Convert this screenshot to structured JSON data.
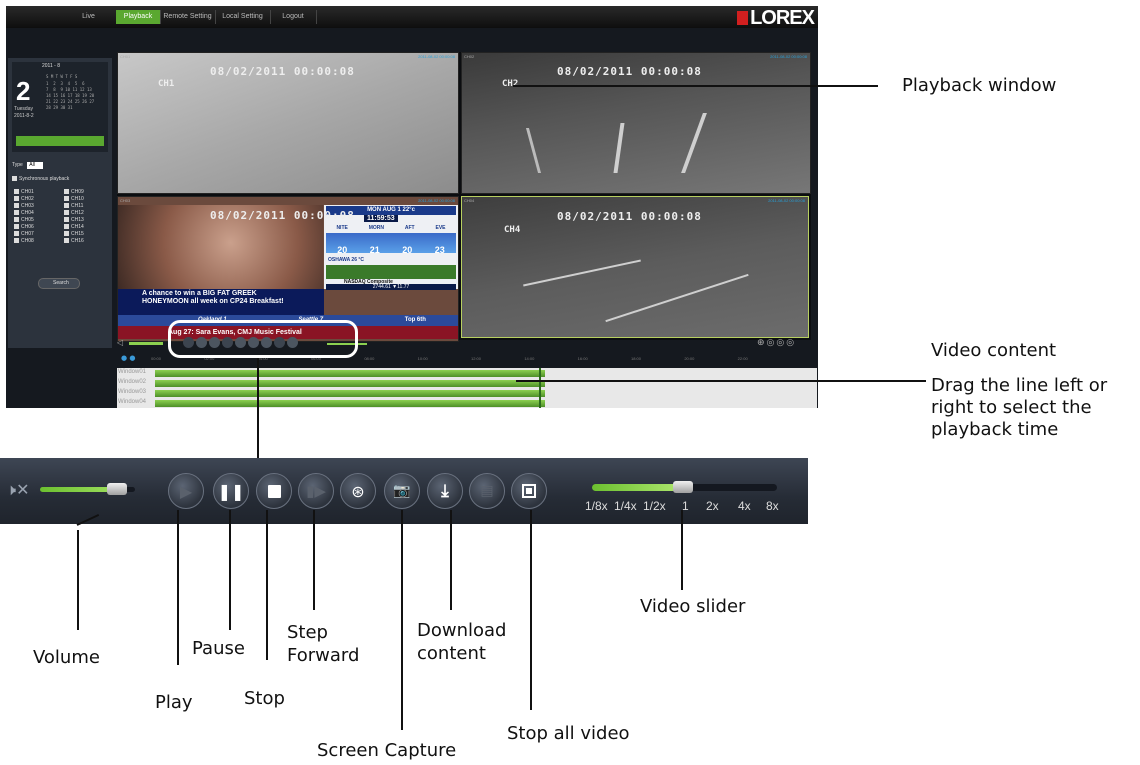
{
  "app": {
    "brand": "LOREX",
    "tabs": [
      {
        "label": "Live",
        "active": false
      },
      {
        "label": "Playback",
        "active": true
      },
      {
        "label": "Remote Setting",
        "active": false
      },
      {
        "label": "Local Setting",
        "active": false
      },
      {
        "label": "Logout",
        "active": false
      }
    ],
    "calendar": {
      "month_year": "2011 - 8",
      "day_number": "2",
      "weekday": "Tuesday",
      "date": "2011-8-2",
      "weekday_headers": "S M T W T F S",
      "days_rows": [
        "1  2  3  4  5  6",
        "7  8  9 10 11 12 13",
        "14 15 16 17 18 19 20",
        "21 22 23 24 25 26 27",
        "28 29 30 31"
      ]
    },
    "type_label": "Type",
    "type_value": "All",
    "sync_label": "Synchronous playback",
    "channels_left": [
      "CH01",
      "CH02",
      "CH03",
      "CH04",
      "CH05",
      "CH06",
      "CH07",
      "CH08"
    ],
    "channels_right": [
      "CH09",
      "CH10",
      "CH11",
      "CH12",
      "CH13",
      "CH14",
      "CH15",
      "CH16"
    ],
    "search_label": "Search",
    "tiles": [
      {
        "header": "CH01",
        "stamp": "2011-08-02 00:00:08",
        "timestamp": "08/02/2011 00:00:08",
        "channel": "CH1"
      },
      {
        "header": "CH02",
        "stamp": "2011-08-02 00:00:08",
        "timestamp": "08/02/2011 00:00:08",
        "channel": "CH2"
      },
      {
        "header": "CH03",
        "stamp": "2011-08-02 00:00:08",
        "timestamp": "08/02/2011 00:00:08",
        "channel": ""
      },
      {
        "header": "CH04",
        "stamp": "2011-08-02 00:00:08",
        "timestamp": "08/02/2011 00:00:08",
        "channel": "CH4"
      }
    ],
    "tv_overlay": {
      "ticker": "A chance to win a BIG FAT GREEK HONEYMOON all week on CP24 Breakfast!",
      "weather_header": "MON AUG 1  22°c",
      "clock": "11:59:53",
      "forecast_labels": [
        "NITE",
        "MORN",
        "AFT",
        "EVE"
      ],
      "forecast_values": [
        "20",
        "21",
        "20",
        "23"
      ],
      "city": "OSHAWA 26 °C",
      "stock_title": "NASDAQ Composite",
      "stock_values": "2744.61   ▼11.77",
      "score_left": "Oakland  1",
      "score_right": "Seattle  7",
      "score_status": "Top 6th",
      "bottom_ticker": "Aug 27: Sara Evans, CMJ Music Festival"
    },
    "windows": [
      "Window01",
      "Window02",
      "Window03",
      "Window04"
    ],
    "time_ticks": [
      "00:00",
      "02:00",
      "04:00",
      "06:00",
      "08:00",
      "10:00",
      "12:00",
      "14:00",
      "16:00",
      "18:00",
      "20:00",
      "22:00"
    ]
  },
  "toolbar": {
    "speed_labels": [
      "1/8x",
      "1/4x",
      "1/2x",
      "1",
      "2x",
      "4x",
      "8x"
    ],
    "volume_level": 0.85,
    "speed_slider_position": 0.5,
    "controls": [
      {
        "name": "play",
        "enabled": false
      },
      {
        "name": "pause",
        "enabled": true
      },
      {
        "name": "stop",
        "enabled": true
      },
      {
        "name": "step-forward",
        "enabled": false
      },
      {
        "name": "screen-capture",
        "enabled": true
      },
      {
        "name": "snapshot",
        "enabled": true
      },
      {
        "name": "download",
        "enabled": true
      },
      {
        "name": "unknown-disabled",
        "enabled": false
      },
      {
        "name": "stop-all",
        "enabled": true
      }
    ]
  },
  "annotations": {
    "playback_window": "Playback window",
    "video_content": "Video content",
    "drag_line": [
      "Drag the line left or",
      "right to select the",
      "playback time"
    ],
    "volume": "Volume",
    "play": "Play",
    "pause": "Pause",
    "stop": "Stop",
    "step_forward": [
      "Step",
      "Forward"
    ],
    "screen_capture": "Screen Capture",
    "download_content": [
      "Download",
      "content"
    ],
    "stop_all_video": "Stop all video",
    "video_slider": "Video slider"
  }
}
